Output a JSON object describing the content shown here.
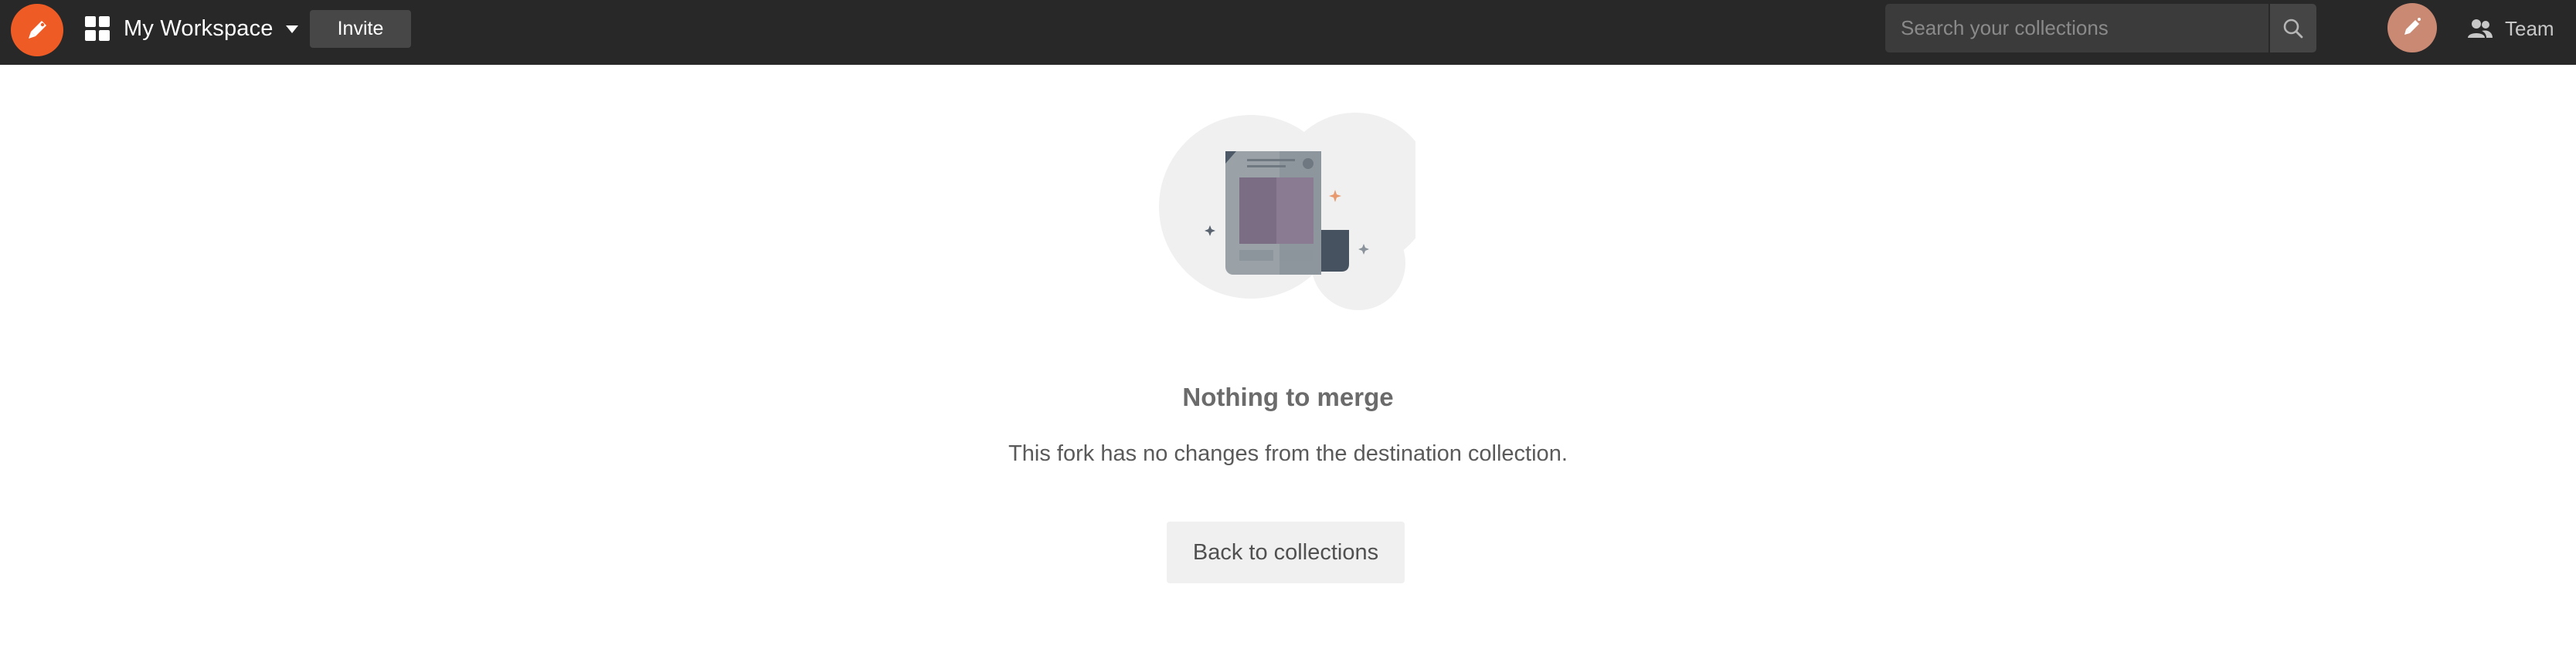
{
  "header": {
    "workspace_name": "My Workspace",
    "invite_label": "Invite",
    "search_placeholder": "Search your collections",
    "team_label": "Team"
  },
  "empty_state": {
    "title": "Nothing to merge",
    "message": "This fork has no changes from the destination collection.",
    "back_button_label": "Back to collections"
  },
  "icons": {
    "logo": "postman-logo-icon",
    "workspace": "workspace-grid-icon",
    "dropdown": "caret-down-icon",
    "search": "search-icon",
    "avatar": "user-avatar-icon",
    "team": "team-icon",
    "illustration": "empty-merge-illustration"
  },
  "colors": {
    "topbar_bg": "#282828",
    "brand_orange": "#ef5b25",
    "button_bg": "#474747",
    "search_bg": "#3b3b3b",
    "title_text": "#6b6b6b",
    "back_button_bg": "#f0f0f0"
  }
}
